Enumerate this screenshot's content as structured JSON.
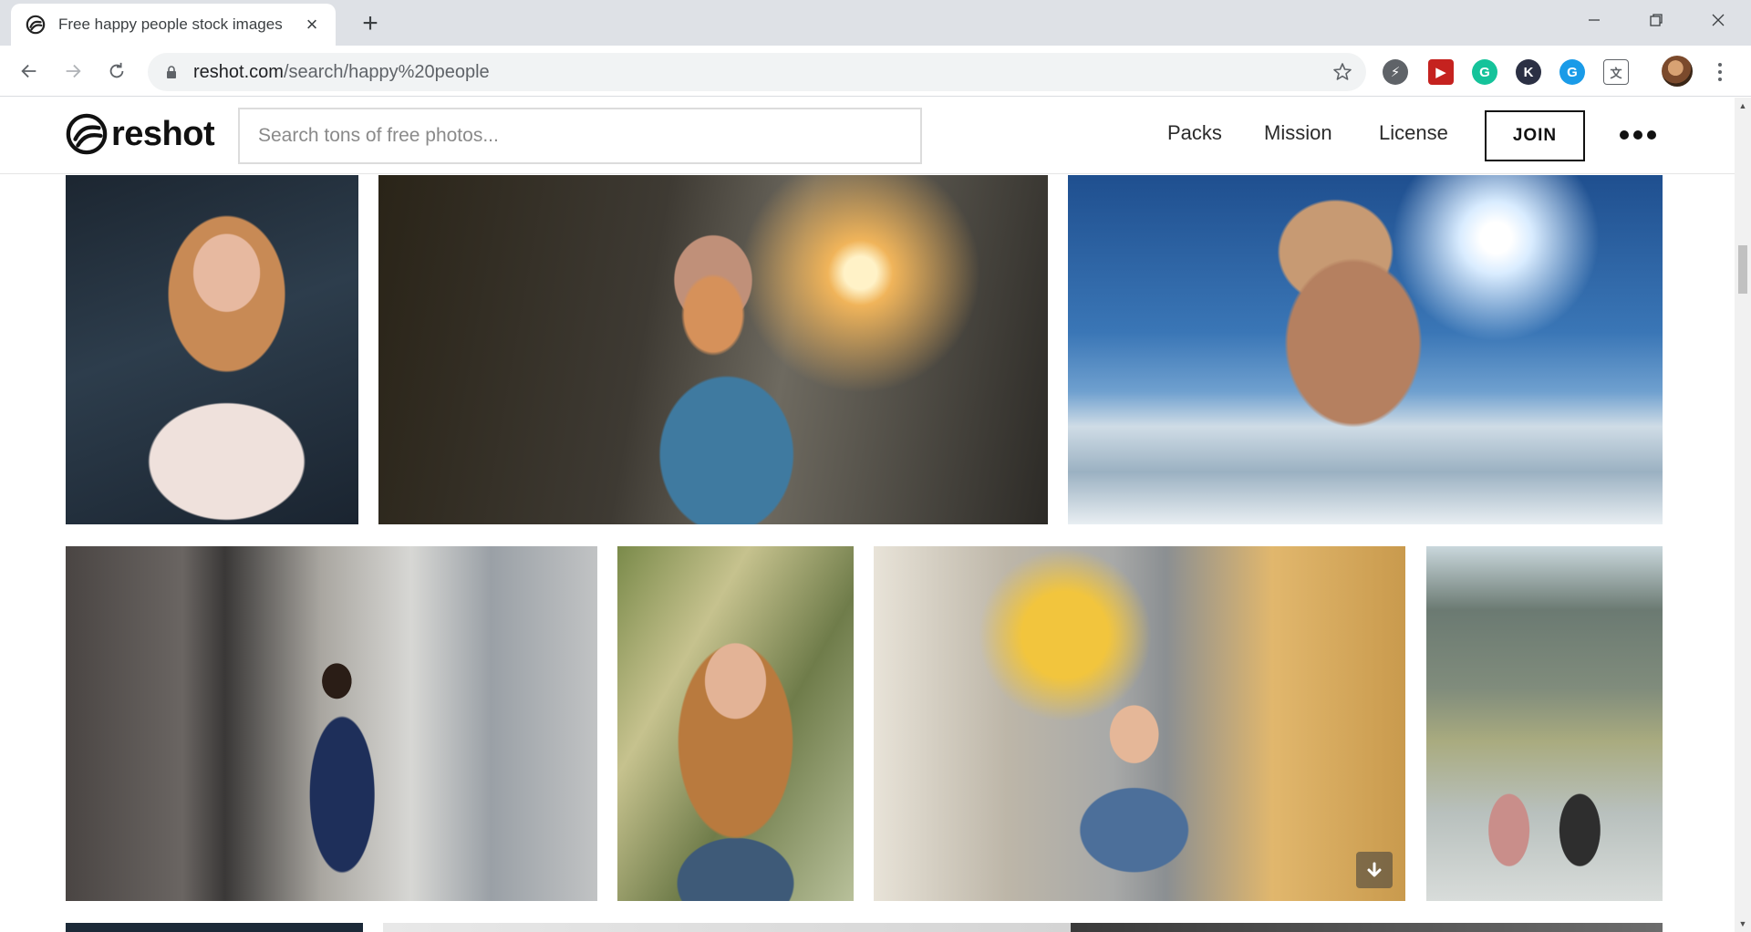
{
  "browser": {
    "tab": {
      "title": "Free happy people stock images",
      "favicon": "reshot-logo-icon"
    },
    "new_tab_label": "+",
    "url_host": "reshot.com",
    "url_path": "/search/happy%20people",
    "extensions": [
      {
        "name": "lightning-extension-icon",
        "color": "#5f6368",
        "glyph": "⚡"
      },
      {
        "name": "video-extension-icon",
        "color": "#c5221f",
        "glyph": "▶"
      },
      {
        "name": "grammarly-extension-icon",
        "color": "#15c39a",
        "glyph": "G"
      },
      {
        "name": "k-extension-icon",
        "color": "#2b3044",
        "glyph": "K"
      },
      {
        "name": "g-extension-icon",
        "color": "#1a9be8",
        "glyph": "G"
      },
      {
        "name": "translate-extension-icon",
        "color": "#5f6368",
        "glyph": "文"
      }
    ]
  },
  "site": {
    "logo_text": "reshot",
    "search_placeholder": "Search tons of free photos...",
    "nav": {
      "packs": "Packs",
      "mission": "Mission",
      "license": "License",
      "join": "JOIN"
    }
  },
  "photos": [
    {
      "name": "photo-woman-glasses-scarf"
    },
    {
      "name": "photo-woman-autumn-leaf"
    },
    {
      "name": "photo-women-beach-selfie"
    },
    {
      "name": "photo-man-street-phone"
    },
    {
      "name": "photo-woman-smiling-portrait"
    },
    {
      "name": "photo-woman-waving-street"
    },
    {
      "name": "photo-couple-mountains"
    }
  ]
}
